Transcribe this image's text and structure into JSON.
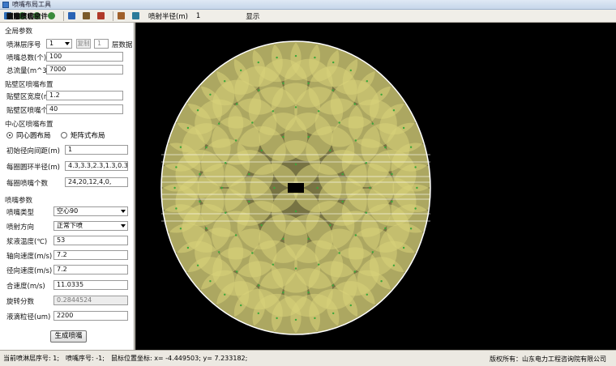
{
  "window": {
    "title": "喷嘴布局工具"
  },
  "toolbar": {
    "items": [
      {
        "label": "喷淋层信息",
        "icon": "info-icon",
        "color": "#2f6fb8"
      },
      {
        "label": "放大",
        "icon": "zoom-in-icon",
        "color": "#3a8a3a"
      },
      {
        "label": "适中",
        "icon": "fit-icon",
        "color": "#3a8a3a"
      },
      {
        "label": "缩小",
        "icon": "zoom-out-icon",
        "color": "#3a8a3a"
      },
      {
        "label": "增加喷嘴",
        "icon": "add-nozzle-icon",
        "color": "#2a63b4"
      },
      {
        "label": "调整喷嘴",
        "icon": "adjust-nozzle-icon",
        "color": "#7a5a2a"
      },
      {
        "label": "删除喷嘴",
        "icon": "delete-nozzle-icon",
        "color": "#b03a2a"
      },
      {
        "label": "喷嘴信息统计",
        "icon": "statistics-icon",
        "color": "#a0602a"
      },
      {
        "label": "生成喷嘴文件",
        "icon": "file-icon",
        "color": "#2a7a9a"
      }
    ],
    "radius_label": "喷射半径(m)",
    "radius_value": "1",
    "display_label": "显示"
  },
  "panel": {
    "global_title": "全局参数",
    "layer_no_label": "喷淋层序号",
    "layer_no_value": "1",
    "copy_button": "复制",
    "copy_value": "1",
    "layer_count_label": "层数据",
    "nozzle_total_label": "喷嘴总数(个)",
    "nozzle_total_value": "100",
    "total_flow_label": "总流量(m^3/h)",
    "total_flow_value": "7000",
    "wall_title": "贴壁区喷嘴布置",
    "wall_width_label": "贴壁区宽度(m)",
    "wall_width_value": "1.2",
    "wall_count_label": "贴壁区喷嘴个数",
    "wall_count_value": "40",
    "center_title": "中心区喷嘴布置",
    "radio_concentric": "同心圆布局",
    "radio_matrix": "矩阵式布局",
    "init_radial_label": "初始径向间距(m)",
    "init_radial_value": "1",
    "ring_radius_label": "每圈圆环半径(m)",
    "ring_radius_value": "4.3,3.3,2.3,1.3,0.3000",
    "ring_count_label": "每圈喷嘴个数",
    "ring_count_value": "24,20,12,4,0,",
    "nozzle_title": "喷嘴参数",
    "nozzle_type_label": "喷嘴类型",
    "nozzle_type_value": "空心90",
    "spray_dir_label": "喷射方向",
    "spray_dir_value": "正常下喷",
    "slurry_temp_label": "浆液温度(℃)",
    "slurry_temp_value": "53",
    "axial_speed_label": "轴向速度(m/s)",
    "axial_speed_value": "7.2",
    "radial_speed_label": "径向速度(m/s)",
    "radial_speed_value": "7.2",
    "total_speed_label": "合速度(m/s)",
    "total_speed_value": "11.0335",
    "swirl_label": "旋转分数",
    "swirl_value": "0.2844524",
    "droplet_label": "液滴粒径(um)",
    "droplet_value": "2200",
    "generate_button": "生成喷嘴"
  },
  "canvas": {
    "background": "#000000",
    "spray_color": "#d8d27a",
    "outline_color": "#ffffff",
    "nozzle_center_color": "#3aa83a"
  },
  "status": {
    "current_layer": "当前喷淋层序号: 1;",
    "nozzle_no": "喷嘴序号: -1;",
    "cursor_pos": "鼠标位置坐标: x= -4.449503; y= 7.233182;",
    "copyright": "版权所有：山东电力工程咨询院有限公司"
  }
}
